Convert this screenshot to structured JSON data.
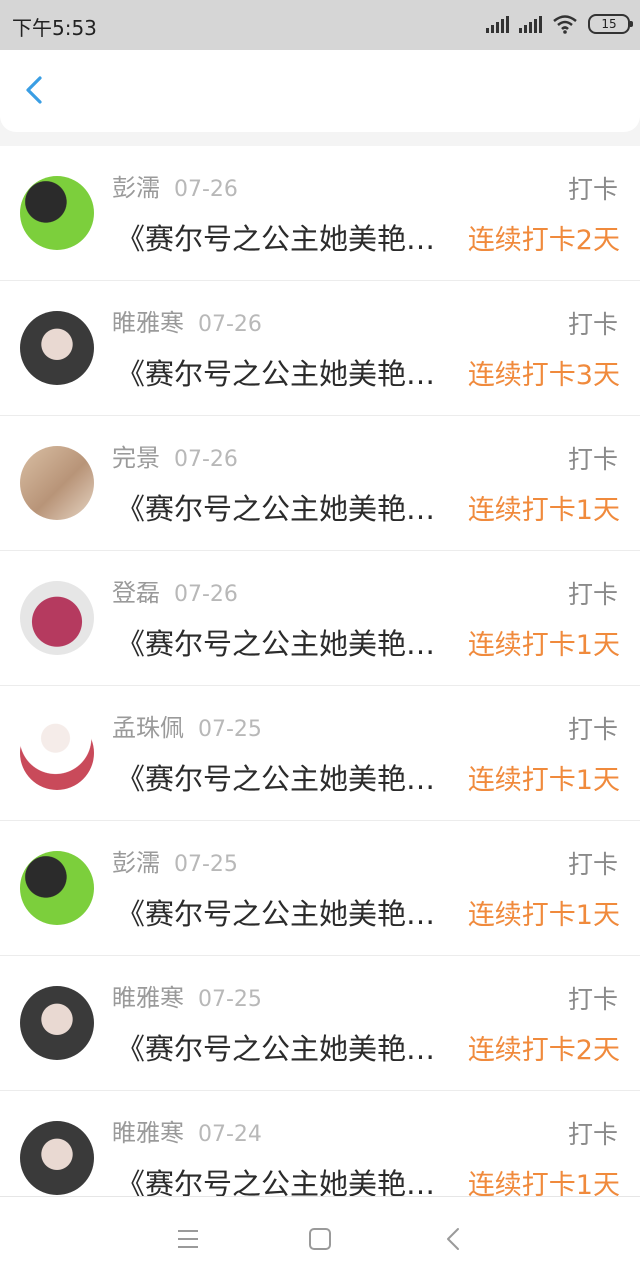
{
  "status_bar": {
    "time": "下午5:53",
    "battery": "15"
  },
  "header": {
    "back_icon": "chevron-left-icon"
  },
  "list": [
    {
      "name": "彭濡",
      "date": "07-26",
      "title": "《赛尔号之公主她美艳…",
      "action": "打卡",
      "streak": "连续打卡2天",
      "avatar_color": "#7ccf3c"
    },
    {
      "name": "睢雅寒",
      "date": "07-26",
      "title": "《赛尔号之公主她美艳…",
      "action": "打卡",
      "streak": "连续打卡3天",
      "avatar_color": "#4a4a4a"
    },
    {
      "name": "完景",
      "date": "07-26",
      "title": "《赛尔号之公主她美艳…",
      "action": "打卡",
      "streak": "连续打卡1天",
      "avatar_color": "#c9a98a"
    },
    {
      "name": "登磊",
      "date": "07-26",
      "title": "《赛尔号之公主她美艳…",
      "action": "打卡",
      "streak": "连续打卡1天",
      "avatar_color": "#b53a5f"
    },
    {
      "name": "孟珠佩",
      "date": "07-25",
      "title": "《赛尔号之公主她美艳…",
      "action": "打卡",
      "streak": "连续打卡1天",
      "avatar_color": "#c94a5a"
    },
    {
      "name": "彭濡",
      "date": "07-25",
      "title": "《赛尔号之公主她美艳…",
      "action": "打卡",
      "streak": "连续打卡1天",
      "avatar_color": "#7ccf3c"
    },
    {
      "name": "睢雅寒",
      "date": "07-25",
      "title": "《赛尔号之公主她美艳…",
      "action": "打卡",
      "streak": "连续打卡2天",
      "avatar_color": "#4a4a4a"
    },
    {
      "name": "睢雅寒",
      "date": "07-24",
      "title": "《赛尔号之公主她美艳…",
      "action": "打卡",
      "streak": "连续打卡1天",
      "avatar_color": "#4a4a4a"
    }
  ],
  "colors": {
    "accent": "#f08a3c",
    "back": "#3a9ee4"
  },
  "nav_bar": {
    "menu_icon": "menu-icon",
    "home_icon": "home-square-icon",
    "back_icon": "back-triangle-icon"
  }
}
